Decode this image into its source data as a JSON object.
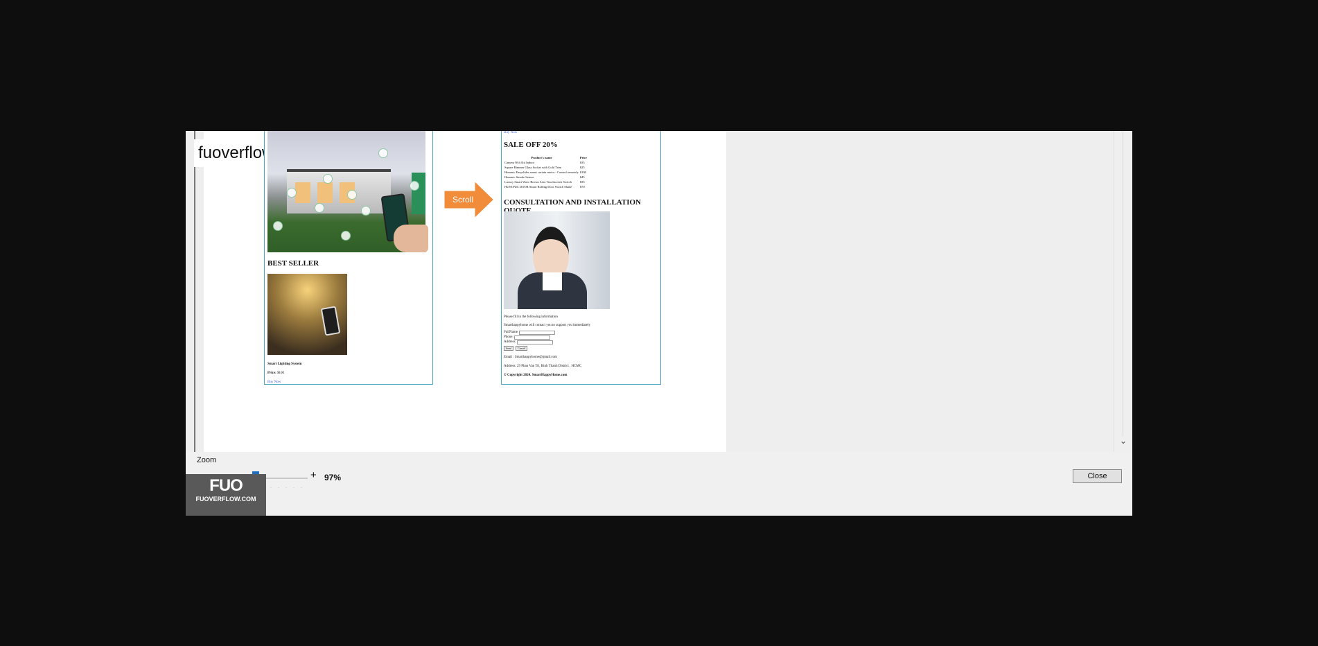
{
  "brand": {
    "text": "fuoverflow"
  },
  "left_page": {
    "best_seller_title": "BEST SELLER",
    "product_name": "Smart Lighting System",
    "price_label": "Price:",
    "price_value": "$100",
    "buy_link": "Buy Now"
  },
  "arrow": {
    "label": "Scroll",
    "color": "#f08c3a"
  },
  "right_page": {
    "top_link": "Buy Now",
    "sale_title": "SALE OFF 20%",
    "table": {
      "headers": [
        "Product's name",
        "Price"
      ],
      "rows": [
        [
          "Camera Wifi Kit Indoor",
          "$35"
        ],
        [
          "Square Rimmer Glass Socket with Gold Trim",
          "$25"
        ],
        [
          "Hunonic Easyslides smart curtain motor - Control remotely",
          "$190"
        ],
        [
          "Hunonic Smoke Sensor",
          "$45"
        ],
        [
          "Luxury Smart Wave Brown Aero Touchscreen Switch",
          "$35"
        ],
        [
          "HUNONIC DOOR Smart Rolling Door Switch Shade",
          "$70"
        ]
      ]
    },
    "consult_title": "CONSULTATION AND INSTALLATION QUOTE",
    "form_intro_1": "Please fill in the following information",
    "form_intro_2": "Smarthappyhome will contact you to support you immediately",
    "form_labels": [
      "FullName:",
      "Phone:",
      "Address:"
    ],
    "form_buttons": [
      "Send",
      "Cancel"
    ],
    "email": "Email : Smarthappyhome@gmail.com",
    "address": "Address: 29 Phan Van Tri, Binh Thanh District , HCMC",
    "copyright": "© Copyright 2024. SmartHappyHome.com"
  },
  "zoom": {
    "label": "Zoom",
    "minus": "-",
    "plus": "+",
    "value": "97%",
    "level": 0.97
  },
  "close_button": "Close",
  "watermark": {
    "mark": "FUO",
    "site": "FUOVERFLOW.COM"
  }
}
